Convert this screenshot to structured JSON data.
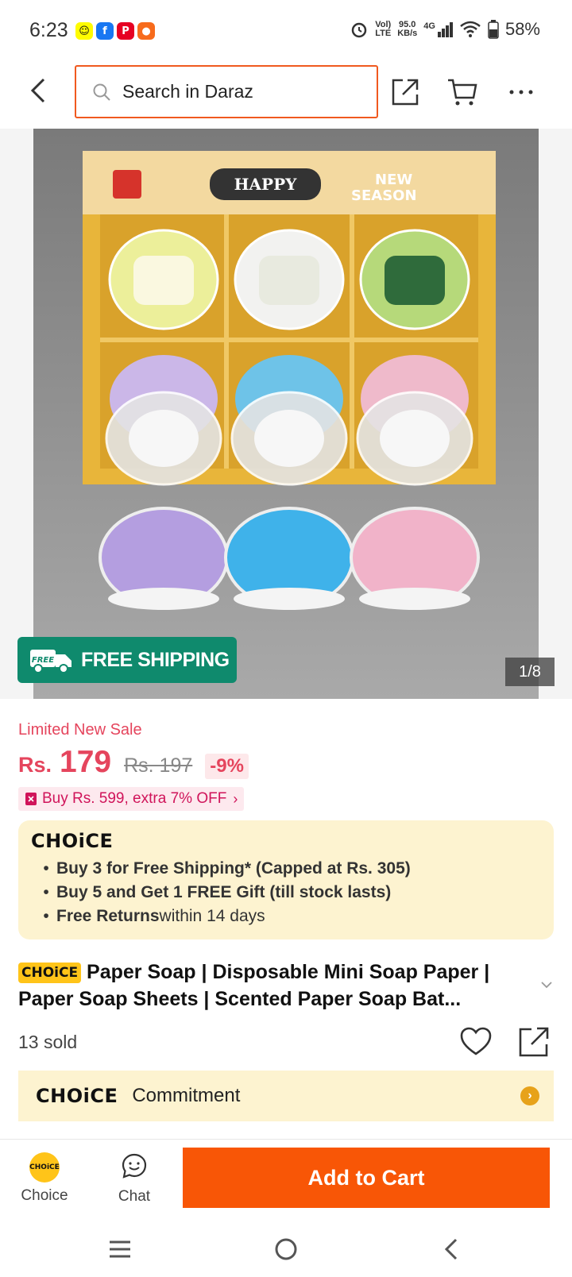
{
  "status_bar": {
    "time": "6:23",
    "apps": [
      {
        "name": "snapchat-icon",
        "glyph": "👻",
        "color": "#fffc00"
      },
      {
        "name": "facebook-icon",
        "glyph": "f",
        "color": "#1877f2"
      },
      {
        "name": "pinterest-icon",
        "glyph": "P",
        "color": "#e60023"
      },
      {
        "name": "app-icon",
        "glyph": "●",
        "color": "#f76b1c"
      }
    ],
    "volte": "Vol)",
    "lte": "LTE",
    "speed": "95.0",
    "speed_unit": "KB/s",
    "network": "4G",
    "battery": "58%"
  },
  "header": {
    "search_placeholder": "Search in Daraz"
  },
  "gallery": {
    "free_shipping": "FREE SHIPPING",
    "free_badge": "FREE",
    "counter": "1/8"
  },
  "price": {
    "sale_label": "Limited New Sale",
    "currency": "Rs.",
    "value": "179",
    "original": "Rs. 197",
    "discount": "-9%",
    "promo": "Buy Rs. 599, extra 7% OFF"
  },
  "choice": {
    "logo": "CHOiCE",
    "bullets": [
      {
        "bold": "Buy 3 for  Free Shipping* (Capped at Rs. 305)",
        "rest": ""
      },
      {
        "bold": "Buy 5 and Get 1 FREE Gift (till stock lasts)",
        "rest": ""
      },
      {
        "bold": "Free Returns",
        "rest": " within 14 days"
      }
    ]
  },
  "product": {
    "tag": "CHOiCE",
    "title": "Paper Soap | Disposable Mini Soap Paper | Paper Soap Sheets | Scented Paper Soap Bat...",
    "sold": "13 sold"
  },
  "commitment": {
    "logo": "CHOiCE",
    "label": "Commitment"
  },
  "bottom_bar": {
    "choice_label": "Choice",
    "choice_icon_text": "CHOiCE",
    "chat_label": "Chat",
    "add_to_cart": "Add to Cart"
  },
  "colors": {
    "accent": "#f85606",
    "price_red": "#e5455d",
    "choice_bg": "#fdf3d0",
    "free_ship_green": "#0f8a6d"
  }
}
